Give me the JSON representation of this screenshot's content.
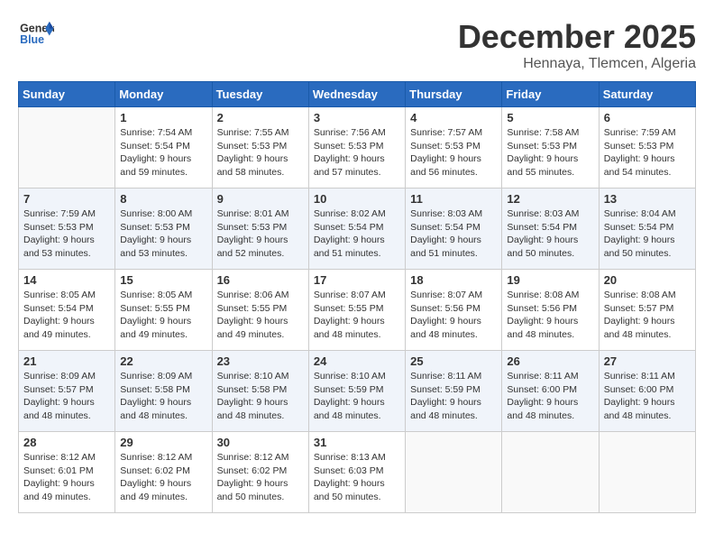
{
  "header": {
    "logo_line1": "General",
    "logo_line2": "Blue",
    "month": "December 2025",
    "location": "Hennaya, Tlemcen, Algeria"
  },
  "days_of_week": [
    "Sunday",
    "Monday",
    "Tuesday",
    "Wednesday",
    "Thursday",
    "Friday",
    "Saturday"
  ],
  "weeks": [
    [
      {
        "day": "",
        "info": ""
      },
      {
        "day": "1",
        "info": "Sunrise: 7:54 AM\nSunset: 5:54 PM\nDaylight: 9 hours\nand 59 minutes."
      },
      {
        "day": "2",
        "info": "Sunrise: 7:55 AM\nSunset: 5:53 PM\nDaylight: 9 hours\nand 58 minutes."
      },
      {
        "day": "3",
        "info": "Sunrise: 7:56 AM\nSunset: 5:53 PM\nDaylight: 9 hours\nand 57 minutes."
      },
      {
        "day": "4",
        "info": "Sunrise: 7:57 AM\nSunset: 5:53 PM\nDaylight: 9 hours\nand 56 minutes."
      },
      {
        "day": "5",
        "info": "Sunrise: 7:58 AM\nSunset: 5:53 PM\nDaylight: 9 hours\nand 55 minutes."
      },
      {
        "day": "6",
        "info": "Sunrise: 7:59 AM\nSunset: 5:53 PM\nDaylight: 9 hours\nand 54 minutes."
      }
    ],
    [
      {
        "day": "7",
        "info": "Sunrise: 7:59 AM\nSunset: 5:53 PM\nDaylight: 9 hours\nand 53 minutes."
      },
      {
        "day": "8",
        "info": "Sunrise: 8:00 AM\nSunset: 5:53 PM\nDaylight: 9 hours\nand 53 minutes."
      },
      {
        "day": "9",
        "info": "Sunrise: 8:01 AM\nSunset: 5:53 PM\nDaylight: 9 hours\nand 52 minutes."
      },
      {
        "day": "10",
        "info": "Sunrise: 8:02 AM\nSunset: 5:54 PM\nDaylight: 9 hours\nand 51 minutes."
      },
      {
        "day": "11",
        "info": "Sunrise: 8:03 AM\nSunset: 5:54 PM\nDaylight: 9 hours\nand 51 minutes."
      },
      {
        "day": "12",
        "info": "Sunrise: 8:03 AM\nSunset: 5:54 PM\nDaylight: 9 hours\nand 50 minutes."
      },
      {
        "day": "13",
        "info": "Sunrise: 8:04 AM\nSunset: 5:54 PM\nDaylight: 9 hours\nand 50 minutes."
      }
    ],
    [
      {
        "day": "14",
        "info": "Sunrise: 8:05 AM\nSunset: 5:54 PM\nDaylight: 9 hours\nand 49 minutes."
      },
      {
        "day": "15",
        "info": "Sunrise: 8:05 AM\nSunset: 5:55 PM\nDaylight: 9 hours\nand 49 minutes."
      },
      {
        "day": "16",
        "info": "Sunrise: 8:06 AM\nSunset: 5:55 PM\nDaylight: 9 hours\nand 49 minutes."
      },
      {
        "day": "17",
        "info": "Sunrise: 8:07 AM\nSunset: 5:55 PM\nDaylight: 9 hours\nand 48 minutes."
      },
      {
        "day": "18",
        "info": "Sunrise: 8:07 AM\nSunset: 5:56 PM\nDaylight: 9 hours\nand 48 minutes."
      },
      {
        "day": "19",
        "info": "Sunrise: 8:08 AM\nSunset: 5:56 PM\nDaylight: 9 hours\nand 48 minutes."
      },
      {
        "day": "20",
        "info": "Sunrise: 8:08 AM\nSunset: 5:57 PM\nDaylight: 9 hours\nand 48 minutes."
      }
    ],
    [
      {
        "day": "21",
        "info": "Sunrise: 8:09 AM\nSunset: 5:57 PM\nDaylight: 9 hours\nand 48 minutes."
      },
      {
        "day": "22",
        "info": "Sunrise: 8:09 AM\nSunset: 5:58 PM\nDaylight: 9 hours\nand 48 minutes."
      },
      {
        "day": "23",
        "info": "Sunrise: 8:10 AM\nSunset: 5:58 PM\nDaylight: 9 hours\nand 48 minutes."
      },
      {
        "day": "24",
        "info": "Sunrise: 8:10 AM\nSunset: 5:59 PM\nDaylight: 9 hours\nand 48 minutes."
      },
      {
        "day": "25",
        "info": "Sunrise: 8:11 AM\nSunset: 5:59 PM\nDaylight: 9 hours\nand 48 minutes."
      },
      {
        "day": "26",
        "info": "Sunrise: 8:11 AM\nSunset: 6:00 PM\nDaylight: 9 hours\nand 48 minutes."
      },
      {
        "day": "27",
        "info": "Sunrise: 8:11 AM\nSunset: 6:00 PM\nDaylight: 9 hours\nand 48 minutes."
      }
    ],
    [
      {
        "day": "28",
        "info": "Sunrise: 8:12 AM\nSunset: 6:01 PM\nDaylight: 9 hours\nand 49 minutes."
      },
      {
        "day": "29",
        "info": "Sunrise: 8:12 AM\nSunset: 6:02 PM\nDaylight: 9 hours\nand 49 minutes."
      },
      {
        "day": "30",
        "info": "Sunrise: 8:12 AM\nSunset: 6:02 PM\nDaylight: 9 hours\nand 50 minutes."
      },
      {
        "day": "31",
        "info": "Sunrise: 8:13 AM\nSunset: 6:03 PM\nDaylight: 9 hours\nand 50 minutes."
      },
      {
        "day": "",
        "info": ""
      },
      {
        "day": "",
        "info": ""
      },
      {
        "day": "",
        "info": ""
      }
    ]
  ]
}
